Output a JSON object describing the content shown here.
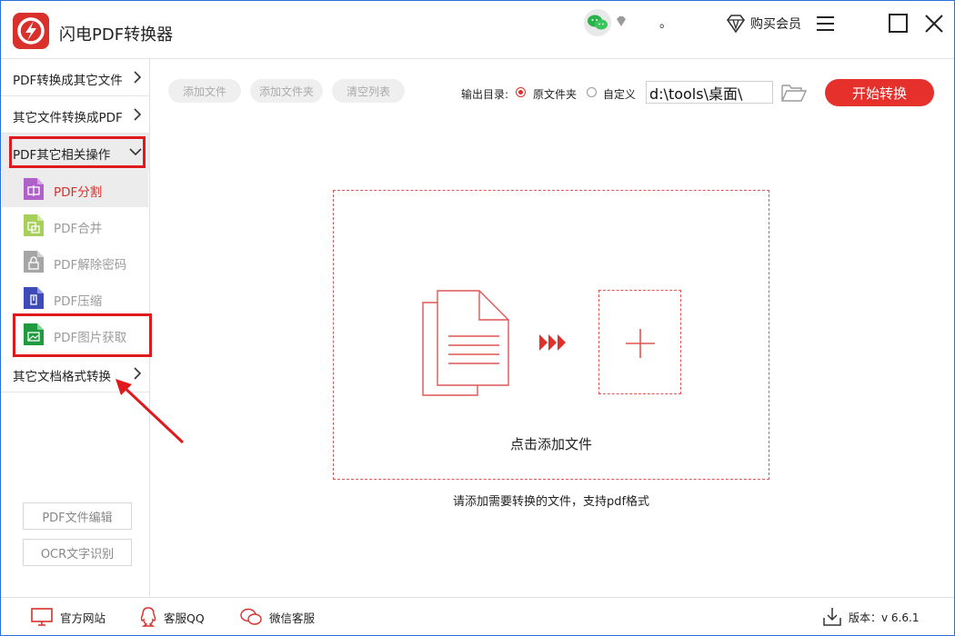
{
  "app": {
    "title": "闪电PDF转换器",
    "dot_text": "。",
    "buy_vip_label": "购买会员"
  },
  "colors": {
    "accent": "#e5302c",
    "highlight_box": "#e0191d",
    "muted_text": "#9a9a9a"
  },
  "sidebar": {
    "categories": [
      {
        "label": "PDF转换成其它文件",
        "icon": "chevron-right-icon"
      },
      {
        "label": "其它文件转换成PDF",
        "icon": "chevron-right-icon"
      },
      {
        "label": "PDF其它相关操作",
        "icon": "chevron-down-icon",
        "expanded": true
      },
      {
        "label": "其它文档格式转换",
        "icon": "chevron-right-icon"
      }
    ],
    "subitems": [
      {
        "label": "PDF分割",
        "icon": "split-file-icon",
        "color": "#b061c9",
        "active": true
      },
      {
        "label": "PDF合并",
        "icon": "merge-file-icon",
        "color": "#a8cf5a"
      },
      {
        "label": "PDF解除密码",
        "icon": "unlock-file-icon",
        "color": "#a6a6a6"
      },
      {
        "label": "PDF压缩",
        "icon": "compress-file-icon",
        "color": "#3d4ab8"
      },
      {
        "label": "PDF图片获取",
        "icon": "image-file-icon",
        "color": "#1f9a3e"
      }
    ],
    "buttons": {
      "edit": "PDF文件编辑",
      "ocr": "OCR文字识别"
    }
  },
  "toolbar": {
    "add_file": "添加文件",
    "add_folder": "添加文件夹",
    "clear_list": "清空列表",
    "output_label": "输出目录:",
    "radio_original": "原文件夹",
    "radio_custom": "自定义",
    "output_path": "d:\\tools\\桌面\\",
    "start": "开始转换"
  },
  "dropzone": {
    "text": "点击添加文件",
    "hint": "请添加需要转换的文件，支持pdf格式"
  },
  "footer": {
    "website": "官方网站",
    "qq": "客服QQ",
    "wechat": "微信客服",
    "version": "版本：v 6.6.1"
  }
}
